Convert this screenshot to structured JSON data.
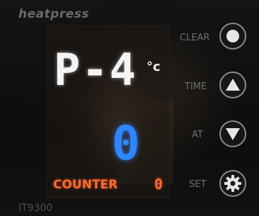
{
  "brand": "heatpress",
  "model": "IT9300",
  "display": {
    "main_readout": "P-4",
    "unit": "°c",
    "secondary_readout": "0",
    "counter_label": "COUNTER",
    "counter_value": "0"
  },
  "buttons": {
    "clear": {
      "label": "CLEAR",
      "icon": "circle-icon"
    },
    "time": {
      "label": "TIME",
      "icon": "triangle-up-icon"
    },
    "at": {
      "label": "AT",
      "icon": "triangle-down-icon"
    },
    "set": {
      "label": "SET",
      "icon": "gear-icon"
    }
  },
  "colors": {
    "main_readout": "#f4f4f4",
    "secondary_readout": "#2f86ff",
    "counter": "#ff6a2a"
  }
}
